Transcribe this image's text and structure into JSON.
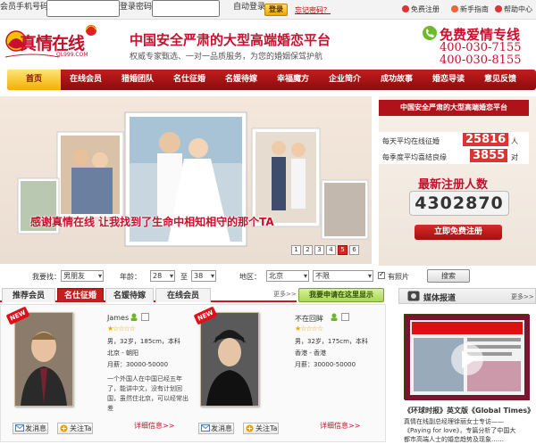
{
  "login": {
    "phone_label": "会员手机号码：",
    "password_label": "登录密码：",
    "auto_login": "自动登录",
    "login_button": "登录",
    "forgot": "忘记密码？"
  },
  "top_links": {
    "register": "免费注册",
    "guide": "新手指南",
    "help": "帮助中心"
  },
  "header": {
    "logo": "真情在线",
    "logo_sub": "QL999.COM",
    "slogan": "中国安全严肃的大型高端婚恋平台",
    "slogan_sub": "权威专家甄选、一对一品质服务，为您的婚姻保驾护航",
    "hotline_title": "免费爱情专线",
    "phone1": "400-030-7155",
    "phone2": "400-030-8155"
  },
  "nav": [
    "首页",
    "在线会员",
    "猎婚团队",
    "名仕征婚",
    "名媛待嫁",
    "幸福魔方",
    "企业简介",
    "成功故事",
    "婚恋导读",
    "意见反馈"
  ],
  "banner": {
    "caption": "感谢真情在线  让我找到了生命中相知相守的那个TA",
    "pages": [
      "1",
      "2",
      "3",
      "4",
      "5",
      "6"
    ],
    "active_page": "5"
  },
  "stats": {
    "headline": "中国安全严肃的大型高端婚恋平台",
    "daily_label": "每天平均在线征婚",
    "daily_value": "25816",
    "daily_unit": "人",
    "season_label": "每季度平均喜结良缘",
    "season_value": "3855",
    "season_unit": "对",
    "reg_title": "最新注册人数",
    "reg_count": "4302870",
    "reg_button": "立即免费注册"
  },
  "search": {
    "find_label": "我要找：",
    "find_value": "男朋友",
    "age_label": "年龄：",
    "age_from": "28",
    "age_to_label": "至",
    "age_to": "38",
    "area_label": "地区：",
    "area_value": "北京",
    "area_sub": "不限",
    "photo_label": "有照片",
    "button": "搜索"
  },
  "member_tabs": [
    "推荐会员",
    "名仕征婚",
    "名媛待嫁",
    "在线会员"
  ],
  "more_label": "更多>>",
  "apply_banner": "我要申请在这里显示",
  "members": [
    {
      "name": "James",
      "info": "男，32岁，185cm，本科",
      "location": "北京 - 朝阳",
      "income": "月薪：30000-50000",
      "intro": "一个外国人在中国已经五年了，能讲中文，没有计划回国，虽然住北京，可以经常出差",
      "detail": "详细信息>>",
      "msg_btn": "发消息",
      "follow_btn": "关注Ta"
    },
    {
      "name": "不在回眸",
      "info": "男，32岁，175cm，本科",
      "location": "香港 - 香港",
      "income": "月薪：30000-50000",
      "intro": "",
      "detail": "详细信息>>",
      "msg_btn": "发消息",
      "follow_btn": "关注Ta"
    }
  ],
  "new_badge": "NEW",
  "media": {
    "title": "媒体报道",
    "more": "更多>>",
    "caption": "《环球时报》英文版《Global Times》",
    "desc1": "真情在线副总经理徐丽女士专访——",
    "desc2": "《Paying for love》，专篇分析了中国大",
    "desc3": "都市高端人士的婚恋趋势及现象……"
  },
  "colors": {
    "brand_red": "#c8102e",
    "nav_red": "#a50f0f",
    "gold": "#f3b000"
  }
}
